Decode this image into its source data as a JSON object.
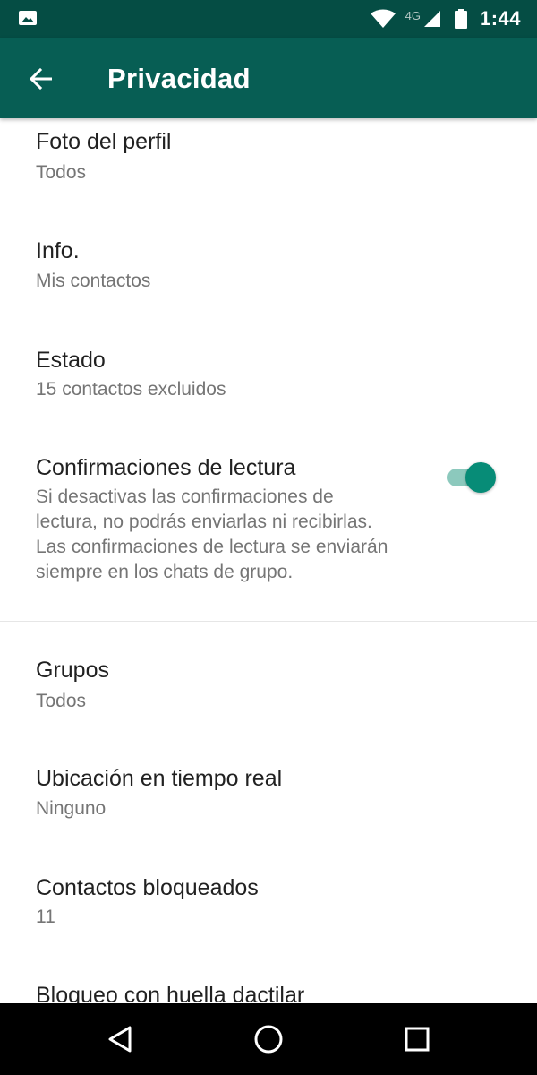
{
  "status_bar": {
    "network": "4G",
    "time": "1:44",
    "icons": [
      "image-icon",
      "wifi-icon",
      "signal-icon",
      "battery-icon"
    ]
  },
  "app_bar": {
    "title": "Privacidad",
    "back_icon": "arrow-back-icon",
    "background_color": "#075e54",
    "status_color": "#054d44"
  },
  "settings": {
    "profile_photo": {
      "label": "Foto del perfil",
      "value": "Todos"
    },
    "info": {
      "label": "Info.",
      "value": "Mis contactos"
    },
    "status": {
      "label": "Estado",
      "value": "15 contactos excluidos"
    },
    "read_receipts": {
      "label": "Confirmaciones de lectura",
      "description_lines": [
        "Si desactivas las confirmaciones de",
        "lectura, no podrás enviarlas ni recibirlas.",
        "Las confirmaciones de lectura se enviarán",
        "siempre en los chats de grupo."
      ],
      "enabled": true,
      "accent_color": "#078c77"
    },
    "groups": {
      "label": "Grupos",
      "value": "Todos"
    },
    "live_location": {
      "label": "Ubicación en tiempo real",
      "value": "Ninguno"
    },
    "blocked_contacts": {
      "label": "Contactos bloqueados",
      "value": "11"
    },
    "fingerprint_lock": {
      "label": "Bloqueo con huella dactilar"
    }
  },
  "nav_bar": {
    "icons": [
      "back-triangle-icon",
      "home-circle-icon",
      "recents-square-icon"
    ]
  }
}
